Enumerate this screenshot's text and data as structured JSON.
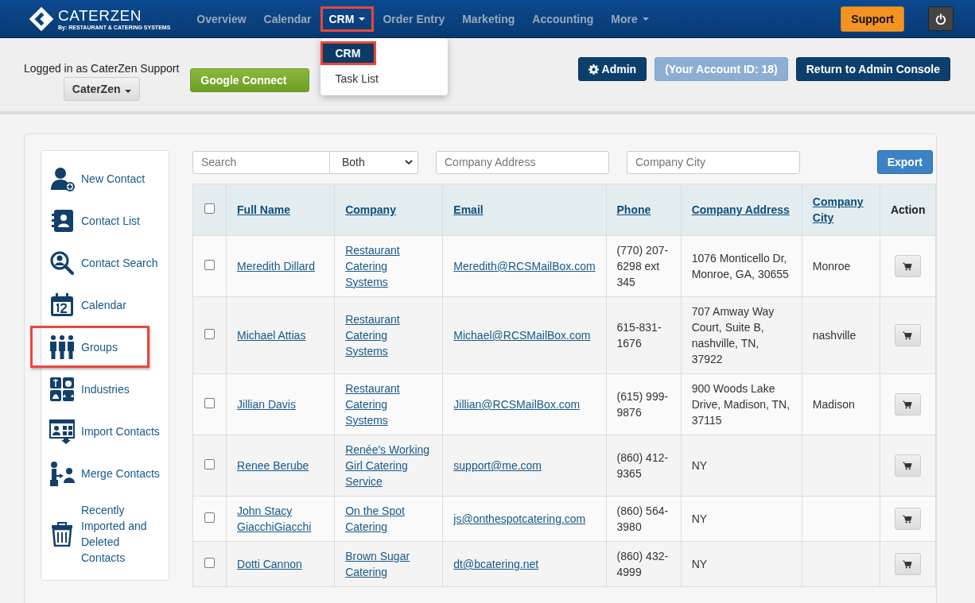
{
  "nav": {
    "logo_text": "CATERZEN",
    "logo_tagline": "By: RESTAURANT & CATERING SYSTEMS",
    "items": [
      {
        "label": "Overview",
        "selected": false,
        "highlighted": false,
        "dropdown": false
      },
      {
        "label": "Calendar",
        "selected": false,
        "highlighted": false,
        "dropdown": false
      },
      {
        "label": "CRM",
        "selected": true,
        "highlighted": true,
        "dropdown": true
      },
      {
        "label": "Order Entry",
        "selected": false,
        "highlighted": false,
        "dropdown": false
      },
      {
        "label": "Marketing",
        "selected": false,
        "highlighted": false,
        "dropdown": false
      },
      {
        "label": "Accounting",
        "selected": false,
        "highlighted": false,
        "dropdown": false
      },
      {
        "label": "More",
        "selected": false,
        "highlighted": false,
        "dropdown": true
      }
    ],
    "support": "Support"
  },
  "crm_menu": [
    {
      "label": "CRM",
      "selected": true,
      "highlighted": true
    },
    {
      "label": "Task List",
      "selected": false,
      "highlighted": false
    }
  ],
  "account": {
    "logged_in": "Logged in as CaterZen Support",
    "company": "CaterZen",
    "google": "Google Connect",
    "admin": "Admin",
    "account_id": "(Your Account ID: 18)",
    "return": "Return to Admin Console"
  },
  "sidebar": [
    {
      "label": "New Contact",
      "highlighted": false
    },
    {
      "label": "Contact List",
      "highlighted": false
    },
    {
      "label": "Contact Search",
      "highlighted": false
    },
    {
      "label": "Calendar",
      "highlighted": false
    },
    {
      "label": "Groups",
      "highlighted": true
    },
    {
      "label": "Industries",
      "highlighted": false
    },
    {
      "label": "Import Contacts",
      "highlighted": false
    },
    {
      "label": "Merge Contacts",
      "highlighted": false
    },
    {
      "label": "Recently Imported and Deleted Contacts",
      "highlighted": false
    }
  ],
  "filters": {
    "search": {
      "placeholder": "Search"
    },
    "scope": "Both",
    "address": {
      "placeholder": "Company Address"
    },
    "city": {
      "placeholder": "Company City"
    },
    "export": "Export"
  },
  "table": {
    "select_all": {
      "checked": false
    },
    "columns": [
      {
        "label": "Full Name",
        "sortable": true
      },
      {
        "label": "Company",
        "sortable": true
      },
      {
        "label": "Email",
        "sortable": true
      },
      {
        "label": "Phone",
        "sortable": true
      },
      {
        "label": "Company Address",
        "sortable": true
      },
      {
        "label": "Company City",
        "sortable": true
      },
      {
        "label": "Action",
        "sortable": false
      }
    ],
    "rows": [
      {
        "checked": false,
        "name": "Meredith Dillard",
        "company": "Restaurant Catering Systems",
        "email": "Meredith@RCSMailBox.com",
        "phone": "(770) 207-6298 ext 345",
        "address": "1076 Monticello Dr, Monroe, GA, 30655",
        "city": "Monroe"
      },
      {
        "checked": false,
        "name": "Michael Attias",
        "company": "Restaurant Catering Systems",
        "email": "Michael@RCSMailBox.com",
        "phone": "615-831-1676",
        "address": "707 Amway Way Court, Suite B, nashville, TN, 37922",
        "city": "nashville"
      },
      {
        "checked": false,
        "name": "Jillian Davis",
        "company": "Restaurant Catering Systems",
        "email": "Jillian@RCSMailBox.com",
        "phone": "(615) 999-9876",
        "address": "900 Woods Lake Drive, Madison, TN, 37115",
        "city": "Madison"
      },
      {
        "checked": false,
        "name": "Renee Berube",
        "company": "Renée's Working Girl Catering Service",
        "email": "support@me.com",
        "phone": "(860) 412-9365",
        "address": "NY"
      },
      {
        "checked": false,
        "name": "John Stacy GiacchiGiacchi",
        "company": "On the Spot Catering",
        "email": "js@onthespotcatering.com",
        "phone": "(860) 564-3980",
        "address": "NY"
      },
      {
        "checked": false,
        "name": "Dotti Cannon",
        "company": "Brown Sugar Catering",
        "email": "dt@bcatering.net",
        "phone": "(860) 432-4999",
        "address": "NY"
      }
    ]
  }
}
